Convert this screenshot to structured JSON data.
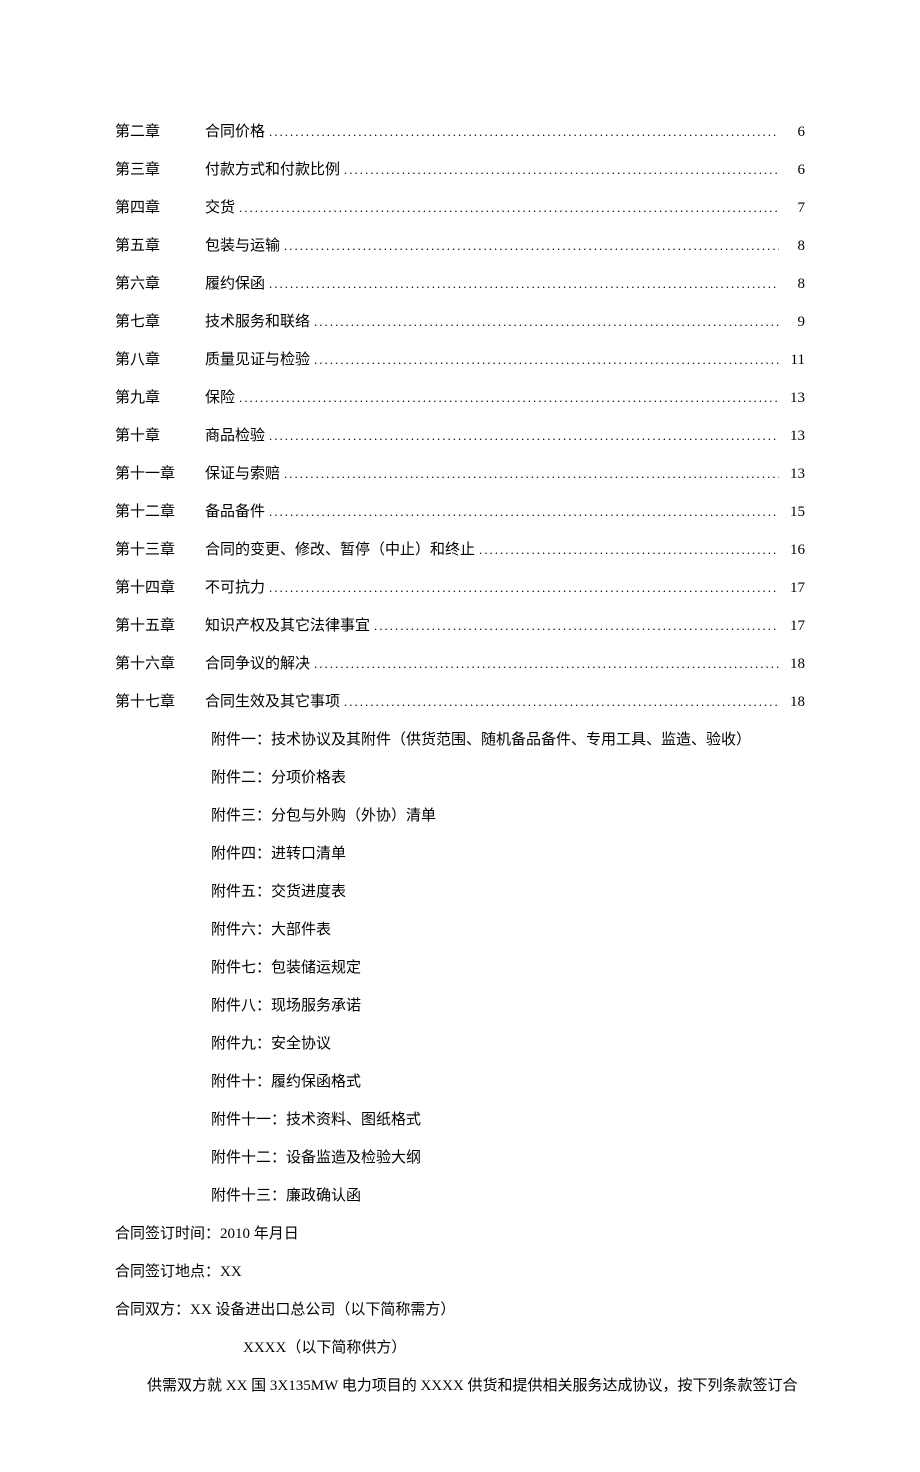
{
  "toc": [
    {
      "chapter": "第二章",
      "title": "合同价格",
      "page": "6"
    },
    {
      "chapter": "第三章",
      "title": "付款方式和付款比例",
      "page": "6"
    },
    {
      "chapter": "第四章",
      "title": "交货",
      "page": "7"
    },
    {
      "chapter": "第五章",
      "title": "包装与运输",
      "page": "8"
    },
    {
      "chapter": "第六章",
      "title": "履约保函",
      "page": "8"
    },
    {
      "chapter": "第七章",
      "title": "技术服务和联络",
      "page": "9"
    },
    {
      "chapter": "第八章",
      "title": "质量见证与检验",
      "page": "11"
    },
    {
      "chapter": "第九章",
      "title": "保险",
      "page": "13"
    },
    {
      "chapter": "第十章",
      "title": "商品检验",
      "page": "13"
    },
    {
      "chapter": "第十一章",
      "title": "保证与索赔",
      "page": "13"
    },
    {
      "chapter": "第十二章",
      "title": "备品备件",
      "page": "15"
    },
    {
      "chapter": "第十三章",
      "title": "合同的变更、修改、暂停（中止）和终止",
      "page": "16"
    },
    {
      "chapter": "第十四章",
      "title": "不可抗力",
      "page": "17"
    },
    {
      "chapter": "第十五章",
      "title": "知识产权及其它法律事宜",
      "page": "17"
    },
    {
      "chapter": "第十六章",
      "title": "合同争议的解决",
      "page": "18"
    },
    {
      "chapter": "第十七章",
      "title": "合同生效及其它事项",
      "page": "18"
    }
  ],
  "appendices": [
    "附件一：技术协议及其附件（供货范围、随机备品备件、专用工具、监造、验收）",
    "附件二：分项价格表",
    "附件三：分包与外购（外协）清单",
    "附件四：进转口清单",
    "附件五：交货进度表",
    "附件六：大部件表",
    "附件七：包装储运规定",
    "附件八：现场服务承诺",
    "附件九：安全协议",
    "附件十：履约保函格式",
    "附件十一：技术资料、图纸格式",
    "附件十二：设备监造及检验大纲",
    "附件十三：廉政确认函"
  ],
  "body": {
    "sign_date": "合同签订时间：2010 年月日",
    "sign_place": "合同签订地点：XX",
    "parties_label": "合同双方：XX 设备进出口总公司（以下简称需方）",
    "supplier": "XXXX（以下简称供方）",
    "agreement": "供需双方就 XX 国 3X135MW 电力项目的 XXXX 供货和提供相关服务达成协议，按下列条款签订合"
  }
}
